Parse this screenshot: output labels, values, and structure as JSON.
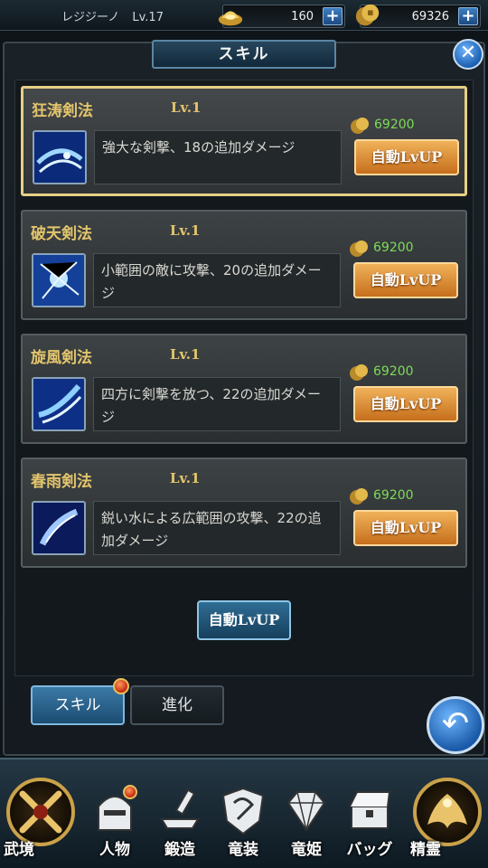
{
  "header": {
    "player_name": "レジジーノ",
    "player_level": "Lv.17",
    "gems": "160",
    "gold": "69326",
    "plus_symbol": "+"
  },
  "panel": {
    "title": "スキル",
    "close_symbol": "✕"
  },
  "skills": [
    {
      "name": "狂涛剣法",
      "level": "Lv.1",
      "description": "強大な剣撃、18の追加ダメージ",
      "cost": "69200",
      "button_label": "自動LvUP"
    },
    {
      "name": "破天剣法",
      "level": "Lv.1",
      "description": "小範囲の敵に攻撃、20の追加ダメージ",
      "cost": "69200",
      "button_label": "自動LvUP"
    },
    {
      "name": "旋風剣法",
      "level": "Lv.1",
      "description": "四方に剣撃を放つ、22の追加ダメージ",
      "cost": "69200",
      "button_label": "自動LvUP"
    },
    {
      "name": "春雨剣法",
      "level": "Lv.1",
      "description": "鋭い水による広範囲の攻撃、22の追加ダメージ",
      "cost": "69200",
      "button_label": "自動LvUP"
    }
  ],
  "all_lvup_label": "自動LvUP",
  "tabs": {
    "skill": "スキル",
    "evolve": "進化"
  },
  "back_symbol": "↶",
  "nav": {
    "realm": "武境",
    "character": "人物",
    "forge": "鍛造",
    "dragon_gear": "竜装",
    "dragon_princess": "竜姫",
    "bag": "バッグ",
    "spirit": "精霊"
  },
  "colors": {
    "gold_text": "#e3c56c",
    "cost_text": "#7ddc58",
    "orange_button": "#c66e1c",
    "blue_button": "#1c4c72"
  }
}
